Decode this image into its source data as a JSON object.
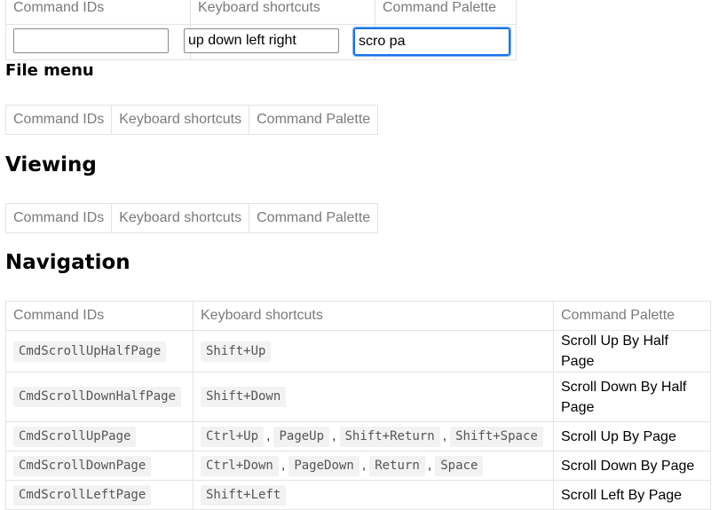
{
  "filter": {
    "headers": [
      "Command IDs",
      "Keyboard shortcuts",
      "Command Palette"
    ],
    "command_ids_value": "",
    "shortcuts_value": "up down left right",
    "palette_value": "scro pa"
  },
  "sections": {
    "file_menu": {
      "title": "File menu",
      "headers": [
        "Command IDs",
        "Keyboard shortcuts",
        "Command Palette"
      ]
    },
    "viewing": {
      "title": "Viewing",
      "headers": [
        "Command IDs",
        "Keyboard shortcuts",
        "Command Palette"
      ]
    },
    "navigation": {
      "title": "Navigation",
      "headers": [
        "Command IDs",
        "Keyboard shortcuts",
        "Command Palette"
      ],
      "rows": [
        {
          "id": "CmdScrollUpHalfPage",
          "keys": [
            "Shift+Up"
          ],
          "palette": "Scroll Up By Half Page"
        },
        {
          "id": "CmdScrollDownHalfPage",
          "keys": [
            "Shift+Down"
          ],
          "palette": "Scroll Down By Half Page"
        },
        {
          "id": "CmdScrollUpPage",
          "keys": [
            "Ctrl+Up",
            "PageUp",
            "Shift+Return",
            "Shift+Space"
          ],
          "palette": "Scroll Up By Page"
        },
        {
          "id": "CmdScrollDownPage",
          "keys": [
            "Ctrl+Down",
            "PageDown",
            "Return",
            "Space"
          ],
          "palette": "Scroll Down By Page"
        },
        {
          "id": "CmdScrollLeftPage",
          "keys": [
            "Shift+Left"
          ],
          "palette": "Scroll Left By Page"
        }
      ]
    }
  }
}
